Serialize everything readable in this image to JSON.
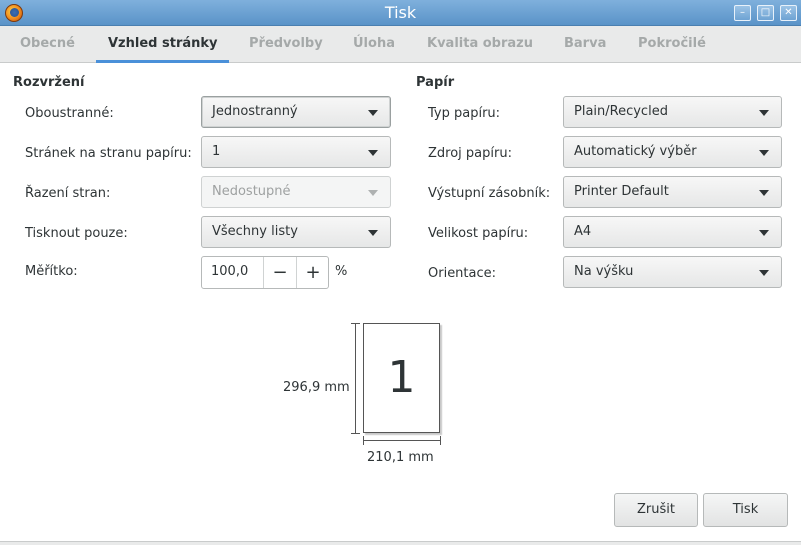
{
  "window": {
    "title": "Tisk",
    "buttons": {
      "minimize": "–",
      "maximize": "□",
      "close": "✕"
    }
  },
  "tabs": [
    {
      "label": "Obecné",
      "active": false
    },
    {
      "label": "Vzhled stránky",
      "active": true
    },
    {
      "label": "Předvolby",
      "active": false
    },
    {
      "label": "Úloha",
      "active": false
    },
    {
      "label": "Kvalita obrazu",
      "active": false
    },
    {
      "label": "Barva",
      "active": false
    },
    {
      "label": "Pokročilé",
      "active": false
    }
  ],
  "layout": {
    "title": "Rozvržení",
    "duplex": {
      "label": "Oboustranné:",
      "value": "Jednostranný"
    },
    "pages_per_sheet": {
      "label": "Stránek na stranu papíru:",
      "value": "1"
    },
    "page_ordering": {
      "label": "Řazení stran:",
      "value": "Nedostupné",
      "disabled": true
    },
    "only_print": {
      "label": "Tisknout pouze:",
      "value": "Všechny listy"
    },
    "scale": {
      "label": "Měřítko:",
      "value": "100,0",
      "minus": "−",
      "plus": "+",
      "unit": "%"
    }
  },
  "paper": {
    "title": "Papír",
    "type": {
      "label": "Typ papíru:",
      "value": "Plain/Recycled"
    },
    "source": {
      "label": "Zdroj papíru:",
      "value": "Automatický výběr"
    },
    "output_tray": {
      "label": "Výstupní zásobník:",
      "value": "Printer Default"
    },
    "size": {
      "label": "Velikost papíru:",
      "value": "A4"
    },
    "orientation": {
      "label": "Orientace:",
      "value": "Na výšku"
    }
  },
  "preview": {
    "page_number": "1",
    "height_text": "296,9 mm",
    "width_text": "210,1 mm"
  },
  "buttons": {
    "cancel": "Zrušit",
    "print": "Tisk"
  },
  "colors": {
    "accent": "#4a90d9",
    "titlebar": "#6ea3d3"
  }
}
